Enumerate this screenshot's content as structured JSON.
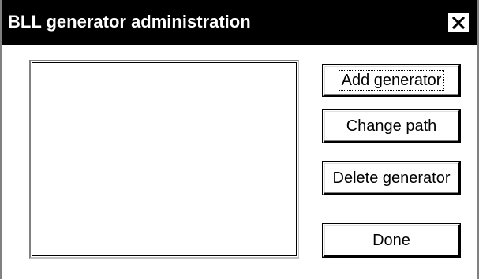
{
  "window": {
    "title": "BLL generator administration",
    "close_icon": "close-icon"
  },
  "generators_list": {
    "items": []
  },
  "buttons": {
    "add_label": "Add generator",
    "change_path_label": "Change path",
    "delete_label": "Delete generator",
    "done_label": "Done"
  },
  "colors": {
    "titlebar": "#000000",
    "title_text": "#ffffff",
    "background": "#ffffff"
  }
}
